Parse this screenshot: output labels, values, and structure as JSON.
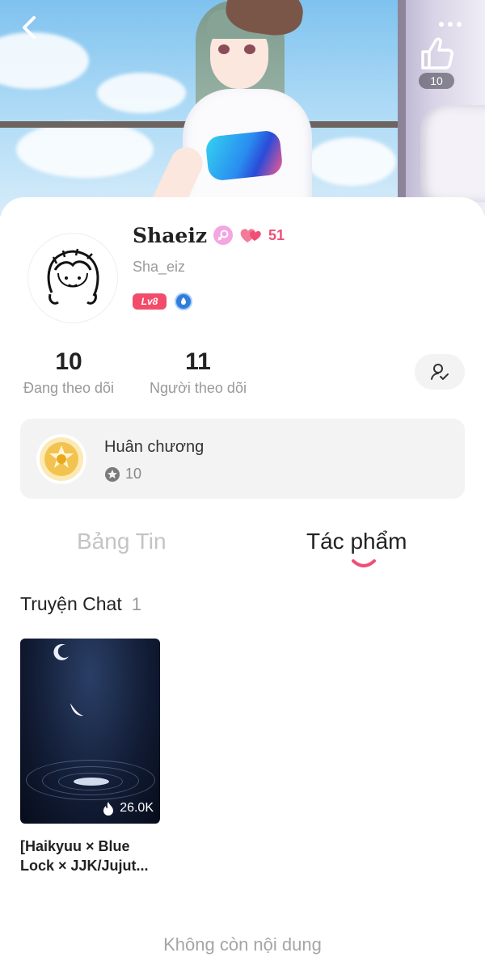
{
  "hero": {
    "like_count": "10"
  },
  "profile": {
    "display_name": "Shaeiz",
    "heart_count": "51",
    "username": "Sha_eiz",
    "level_badge": "Lv8"
  },
  "stats": {
    "following_count": "10",
    "following_label": "Đang theo dõi",
    "followers_count": "11",
    "followers_label": "Người theo dõi"
  },
  "medals": {
    "title": "Huân chương",
    "count": "10"
  },
  "tabs": [
    {
      "label": "Bảng Tin",
      "active": false
    },
    {
      "label": "Tác phẩm",
      "active": true
    }
  ],
  "section": {
    "title": "Truyện Chat",
    "count": "1"
  },
  "stories": [
    {
      "title": "[Haikyuu × Blue Lock × JJK/Jujut...",
      "views": "26.0K"
    }
  ],
  "footer": {
    "end_text": "Không còn nội dung"
  },
  "colors": {
    "accent": "#f24c6a",
    "heart": "#ef4f77",
    "tab_underline": "#ef4f77"
  }
}
